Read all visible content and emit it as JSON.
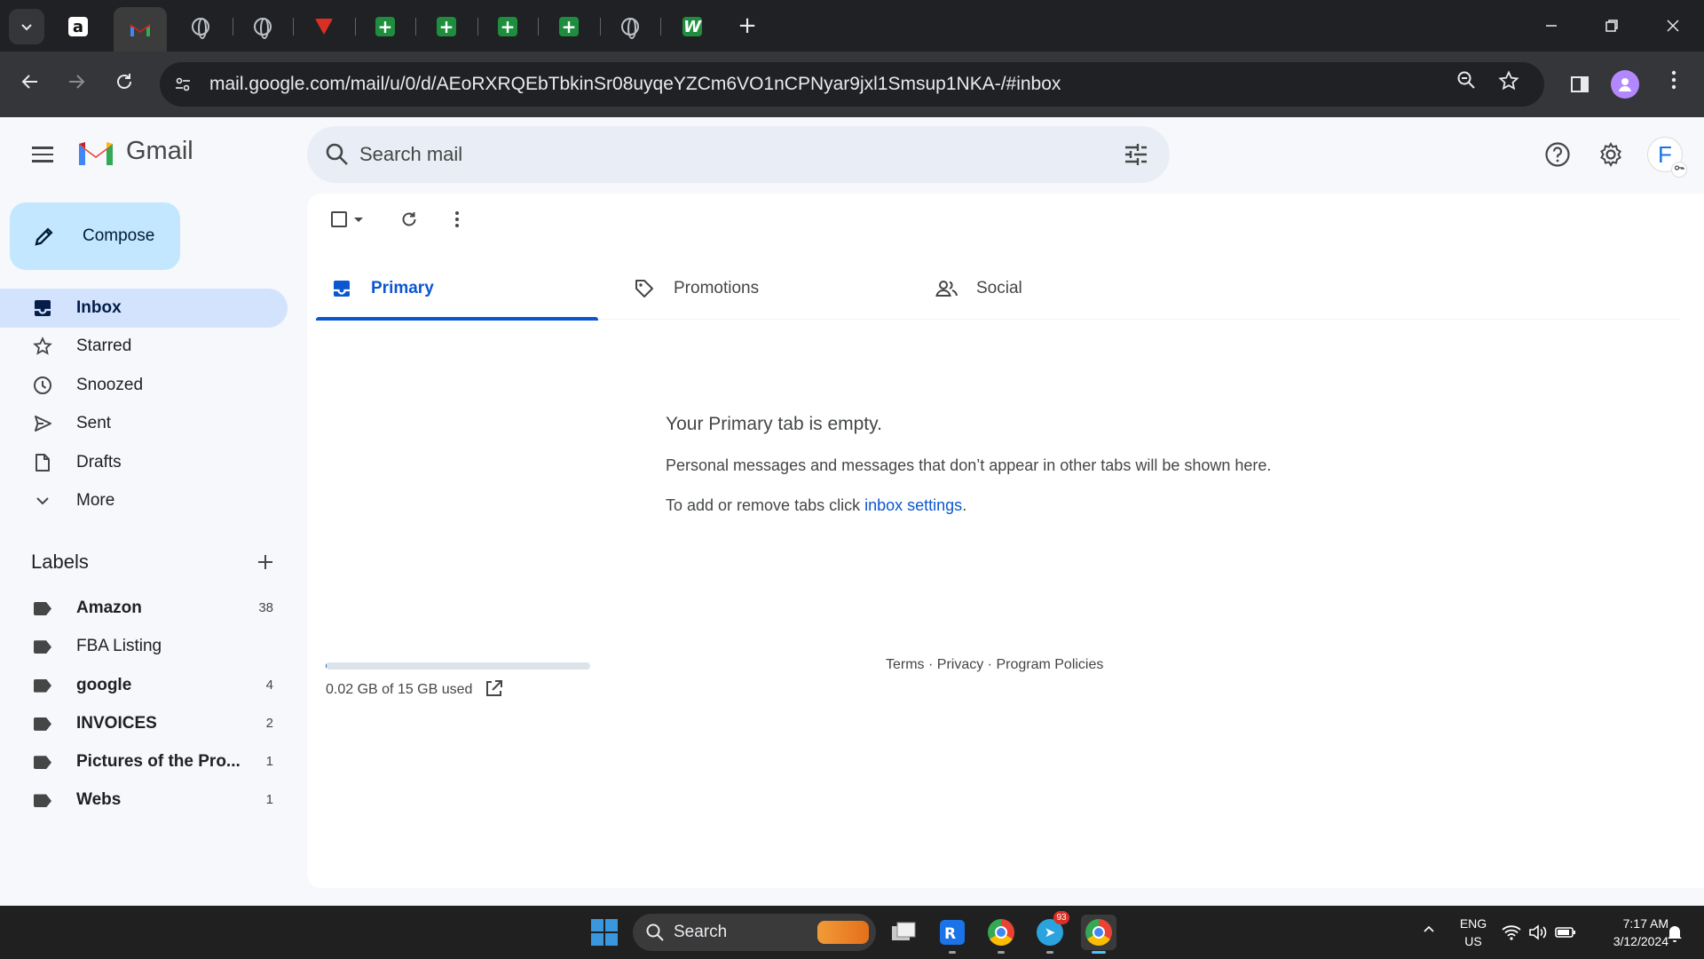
{
  "browser": {
    "tabs": [
      {
        "icon": "amazon-icon"
      },
      {
        "icon": "gmail-icon",
        "active": true
      },
      {
        "icon": "globe-icon"
      },
      {
        "icon": "globe-icon"
      },
      {
        "icon": "red-shield-icon"
      },
      {
        "icon": "sheets-icon"
      },
      {
        "icon": "sheets-icon"
      },
      {
        "icon": "sheets-icon"
      },
      {
        "icon": "sheets-icon"
      },
      {
        "icon": "globe-icon"
      },
      {
        "icon": "w-app-icon"
      }
    ],
    "new_tab_symbol": "+",
    "url": "mail.google.com/mail/u/0/d/AEoRXRQEbTbkinSr08uyqeYZCm6VO1nCPNyar9jxl1Smsup1NKA-/#inbox"
  },
  "gmail": {
    "wordmark": "Gmail",
    "search_placeholder": "Search mail",
    "avatar_initial": "F",
    "compose_label": "Compose",
    "nav": [
      {
        "label": "Inbox",
        "icon": "inbox-icon",
        "active": true
      },
      {
        "label": "Starred",
        "icon": "star-icon"
      },
      {
        "label": "Snoozed",
        "icon": "clock-icon"
      },
      {
        "label": "Sent",
        "icon": "send-icon"
      },
      {
        "label": "Drafts",
        "icon": "draft-icon"
      },
      {
        "label": "More",
        "icon": "chevron-down-icon"
      }
    ],
    "labels_heading": "Labels",
    "labels": [
      {
        "name": "Amazon",
        "count": "38",
        "bold": true
      },
      {
        "name": "FBA Listing",
        "count": "",
        "bold": false
      },
      {
        "name": "google",
        "count": "4",
        "bold": true
      },
      {
        "name": "INVOICES",
        "count": "2",
        "bold": true
      },
      {
        "name": "Pictures of the Pro...",
        "count": "1",
        "bold": true
      },
      {
        "name": "Webs",
        "count": "1",
        "bold": true
      }
    ],
    "tabs": [
      {
        "label": "Primary",
        "icon": "inbox-tab-icon",
        "active": true
      },
      {
        "label": "Promotions",
        "icon": "tag-icon"
      },
      {
        "label": "Social",
        "icon": "people-icon"
      }
    ],
    "empty_state": {
      "title": "Your Primary tab is empty.",
      "description": "Personal messages and messages that don’t appear in other tabs will be shown here.",
      "hint_prefix": "To add or remove tabs click ",
      "hint_link": "inbox settings",
      "hint_suffix": "."
    },
    "storage": {
      "text": "0.02 GB of 15 GB used",
      "fraction_used": 0.0013
    },
    "footer": "Terms · Privacy · Program Policies",
    "colors": {
      "accent": "#0b57d0",
      "compose_bg": "#c2e7ff",
      "active_nav_bg": "#d3e3fd"
    }
  },
  "taskbar": {
    "search_label": "Search",
    "telegram_badge": "93",
    "language_line1": "ENG",
    "language_line2": "US",
    "time": "7:17 AM",
    "date": "3/12/2024"
  }
}
